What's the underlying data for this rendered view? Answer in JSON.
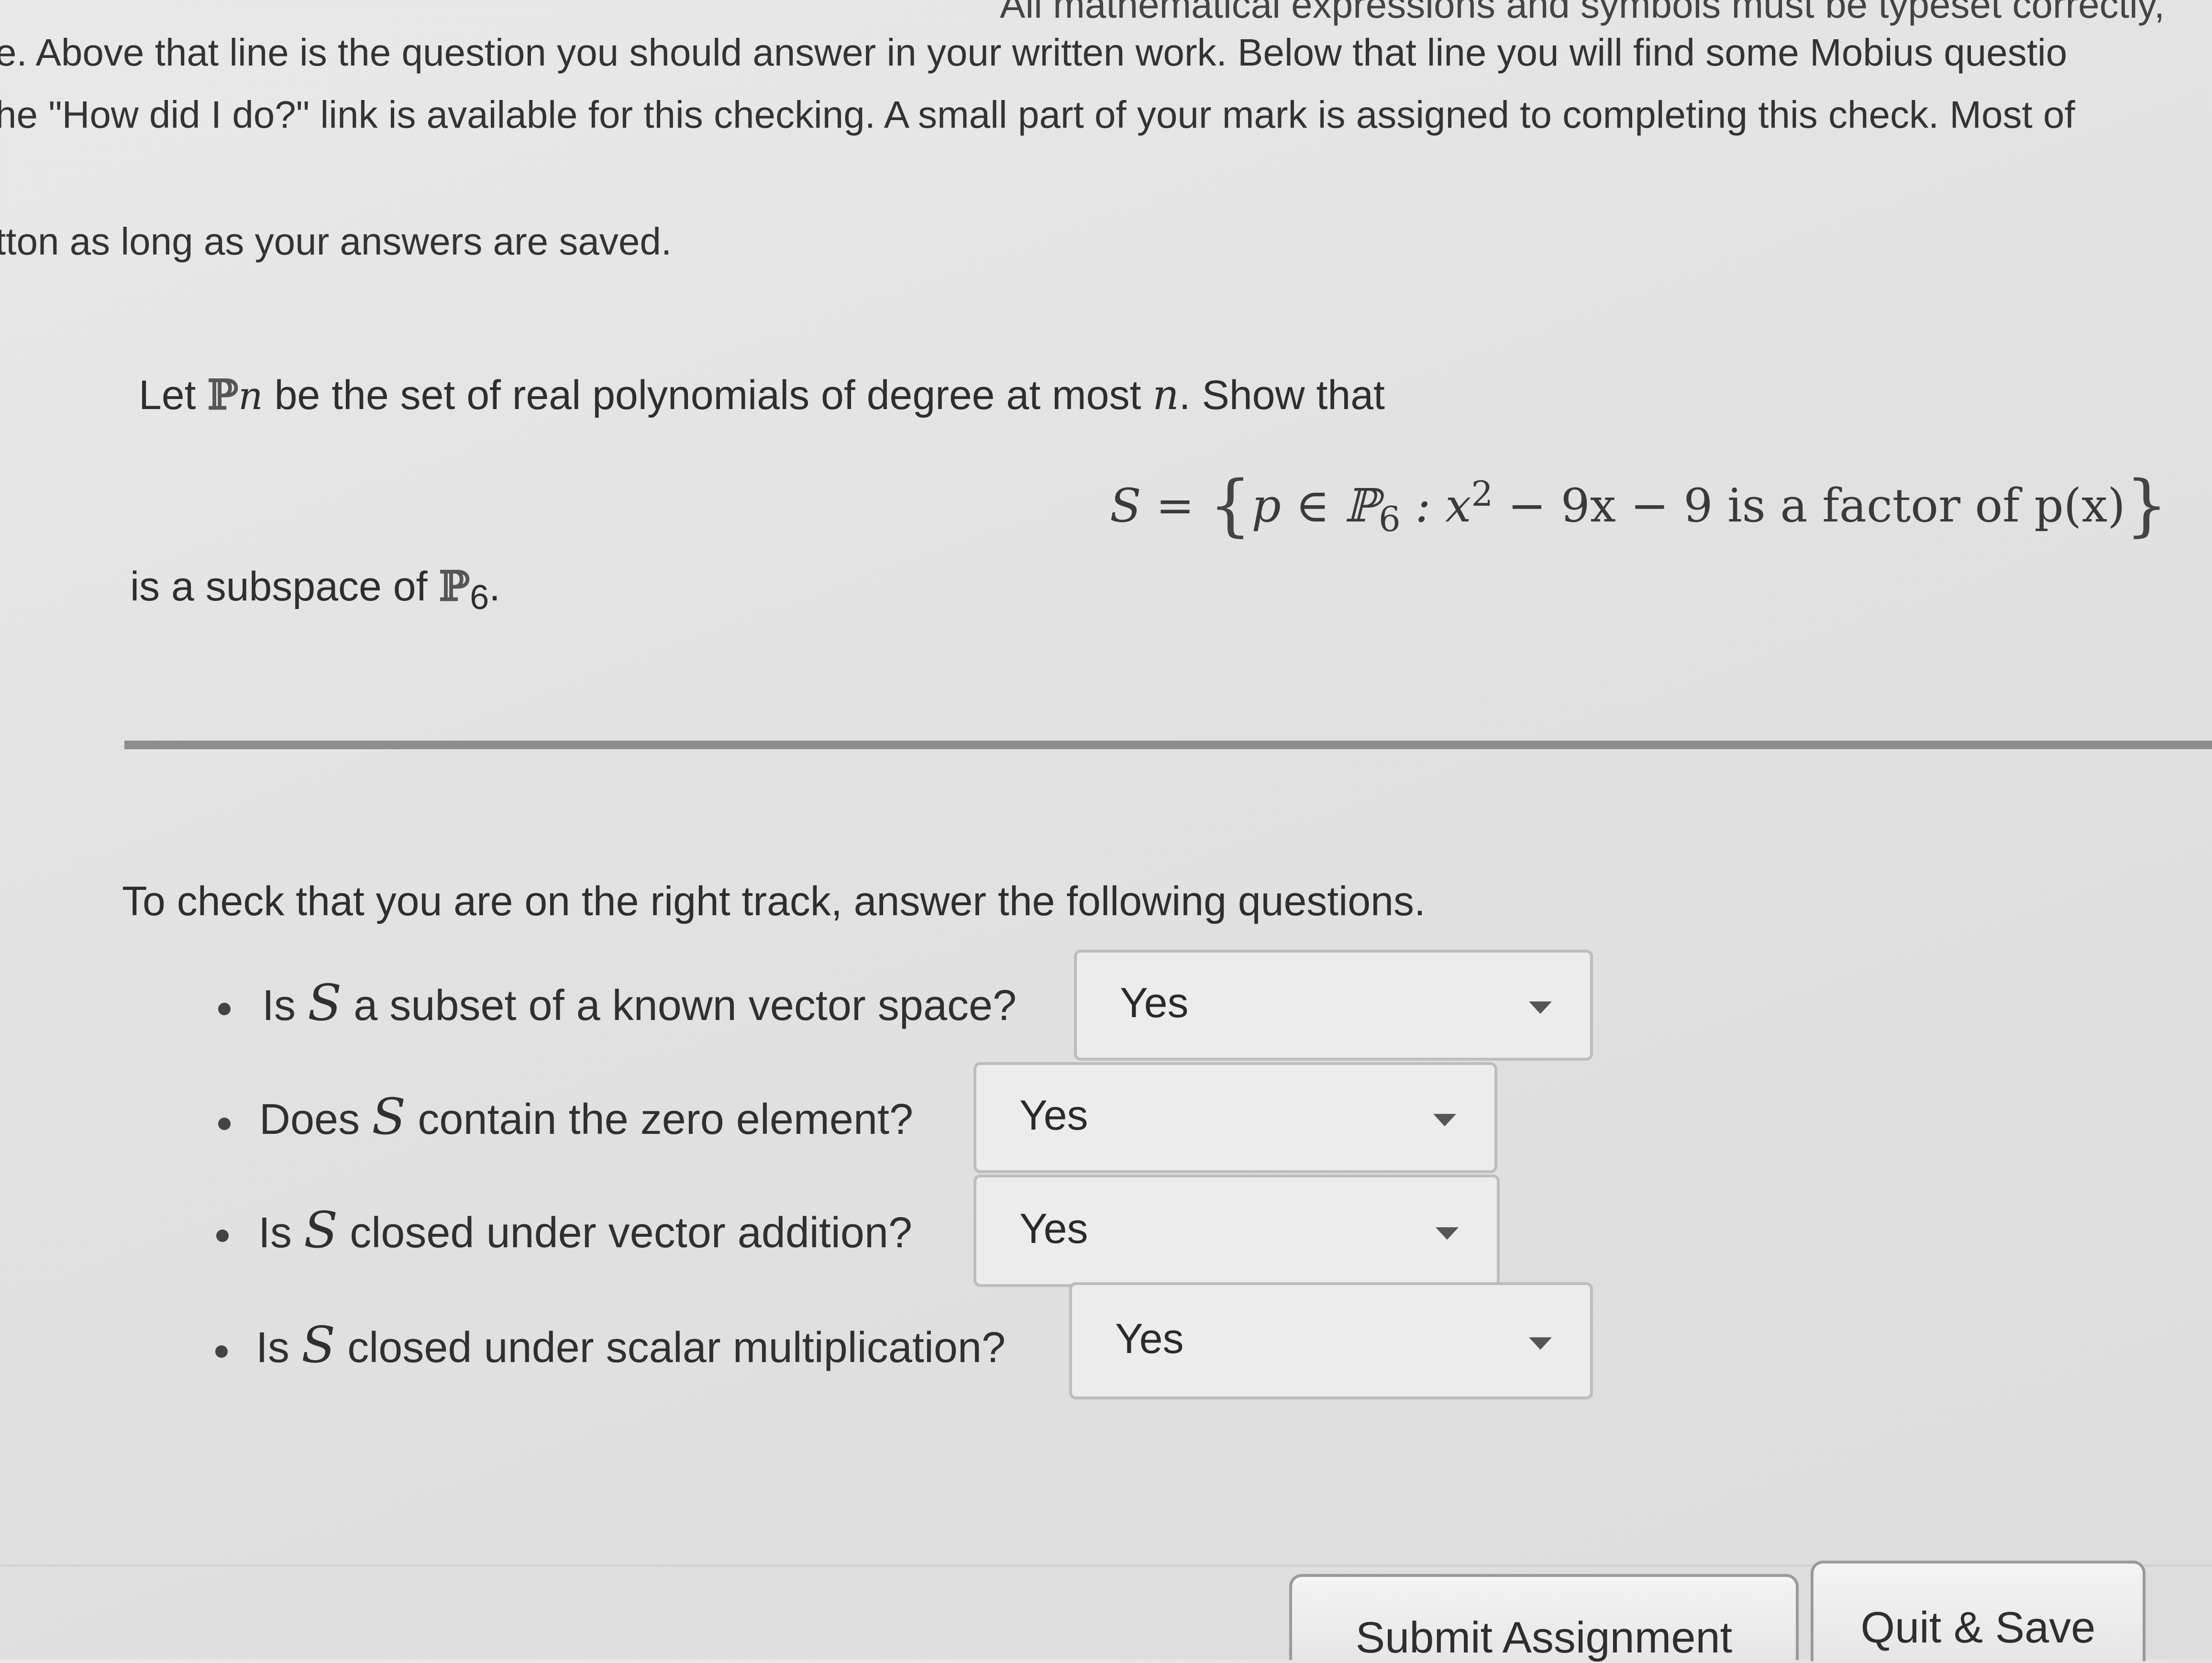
{
  "intro": {
    "line1": "All mathematical expressions and symbols must be typeset correctly,",
    "line2": "e.  Above that line is the question you should answer in your written work.  Below that line you will find some Mobius questio",
    "line3": "he \"How did I do?\" link is available for this checking.  A small part of your mark is assigned to completing this check.  Most of",
    "line4": "tton as long as your answers are saved."
  },
  "question": {
    "let": "Let",
    "p_symbol": "ℙ",
    "n_symbol": "n",
    "line1_rest": "be the set of real polynomials of degree at most",
    "show_that": ". Show that",
    "formula_lhs": "S =",
    "formula_body": "p ∈ ℙ",
    "formula_sub": "6",
    "formula_rest": " : x",
    "formula_sup": "2",
    "formula_tail": " − 9x − 9 is a factor of p(x)",
    "line2_prefix": "is a subspace of",
    "line2_sub": "6",
    "line2_end": "."
  },
  "check": {
    "intro": "To check that you are on the right track, answer the following questions.",
    "items": [
      {
        "pre": "Is",
        "var": "S",
        "post": "a subset of a known vector space?",
        "answer": "Yes"
      },
      {
        "pre": "Does",
        "var": "S",
        "post": "contain the zero element?",
        "answer": "Yes"
      },
      {
        "pre": "Is",
        "var": "S",
        "post": "closed under vector addition?",
        "answer": "Yes"
      },
      {
        "pre": "Is",
        "var": "S",
        "post": "closed under scalar multiplication?",
        "answer": "Yes"
      }
    ]
  },
  "buttons": {
    "submit": "Submit Assignment",
    "quit": "Quit & Save"
  }
}
